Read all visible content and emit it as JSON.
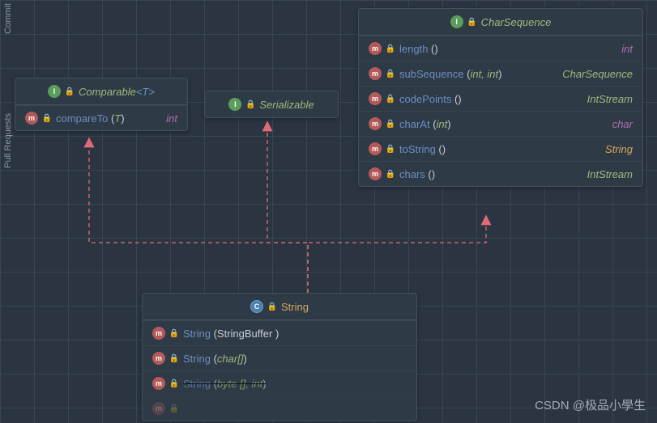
{
  "sidebar": {
    "commit": "Commit",
    "pull_requests": "Pull Requests"
  },
  "comparable": {
    "title_prefix": "Comparable",
    "title_param": "<T>",
    "methods": [
      {
        "name": "compareTo",
        "params": "T",
        "return": "int",
        "ret_class": "ret-int"
      }
    ]
  },
  "serializable": {
    "title": "Serializable"
  },
  "charsequence": {
    "title": "CharSequence",
    "methods": [
      {
        "name": "length",
        "params": "",
        "return": "int",
        "ret_class": "ret-int"
      },
      {
        "name": "subSequence",
        "params": "int, int",
        "return": "CharSequence",
        "ret_class": "ret-cs"
      },
      {
        "name": "codePoints",
        "params": "",
        "return": "IntStream",
        "ret_class": "ret-is"
      },
      {
        "name": "charAt",
        "params": "int",
        "return": "char",
        "ret_class": "ret-char"
      },
      {
        "name": "toString",
        "params": "",
        "return": "String",
        "ret_class": "ret-str"
      },
      {
        "name": "chars",
        "params": "",
        "return": "IntStream",
        "ret_class": "ret-is"
      }
    ]
  },
  "string": {
    "title": "String",
    "constructors": [
      {
        "name": "String",
        "params_html": "StringBuffer ",
        "deprecated": false
      },
      {
        "name": "String",
        "params_html": "char[]",
        "deprecated": false,
        "param_italic": true
      },
      {
        "name": "String",
        "params_html": "byte [], int",
        "deprecated": true,
        "param_italic": true
      }
    ]
  },
  "watermark": "CSDN @极品小學生"
}
